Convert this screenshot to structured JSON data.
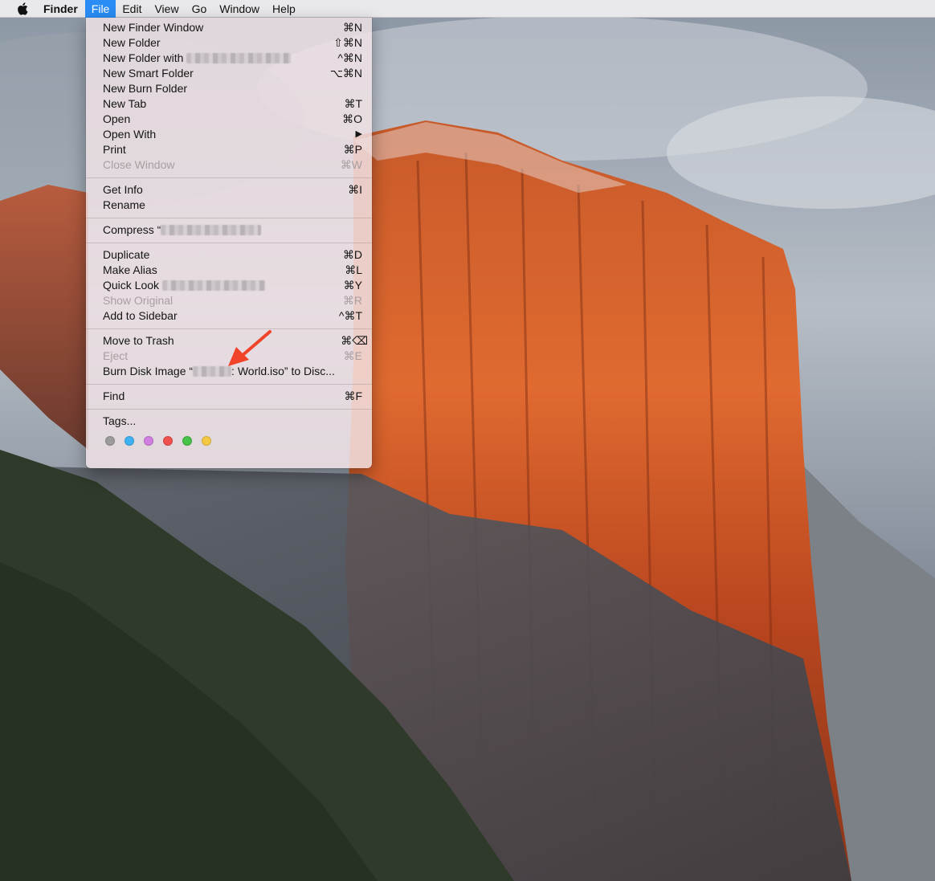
{
  "menubar": {
    "app_name": "Finder",
    "items": [
      "File",
      "Edit",
      "View",
      "Go",
      "Window",
      "Help"
    ],
    "active_item": "File"
  },
  "file_menu": {
    "groups": [
      [
        {
          "label": "New Finder Window",
          "shortcut": "⌘N"
        },
        {
          "label": "New Folder",
          "shortcut": "⇧⌘N"
        },
        {
          "label": "New Folder with",
          "shortcut": "^⌘N",
          "redacted": true
        },
        {
          "label": "New Smart Folder",
          "shortcut": "⌥⌘N"
        },
        {
          "label": "New Burn Folder",
          "shortcut": ""
        },
        {
          "label": "New Tab",
          "shortcut": "⌘T"
        },
        {
          "label": "Open",
          "shortcut": "⌘O"
        },
        {
          "label": "Open With",
          "shortcut": "▶"
        },
        {
          "label": "Print",
          "shortcut": "⌘P"
        },
        {
          "label": "Close Window",
          "shortcut": "⌘W",
          "disabled": true
        }
      ],
      [
        {
          "label": "Get Info",
          "shortcut": "⌘I"
        },
        {
          "label": "Rename",
          "shortcut": ""
        }
      ],
      [
        {
          "label": "Compress “",
          "shortcut": "",
          "redacted": true
        }
      ],
      [
        {
          "label": "Duplicate",
          "shortcut": "⌘D"
        },
        {
          "label": "Make Alias",
          "shortcut": "⌘L"
        },
        {
          "label": "Quick Look",
          "shortcut": "⌘Y",
          "redacted": true
        },
        {
          "label": "Show Original",
          "shortcut": "⌘R",
          "disabled": true
        },
        {
          "label": "Add to Sidebar",
          "shortcut": "^⌘T"
        }
      ],
      [
        {
          "label": "Move to Trash",
          "shortcut": "⌘⌫"
        },
        {
          "label": "Eject",
          "shortcut": "⌘E",
          "disabled": true
        },
        {
          "label": "Burn Disk Image “",
          "label_after": ": World.iso” to Disc...",
          "shortcut": "",
          "redacted": true
        }
      ],
      [
        {
          "label": "Find",
          "shortcut": "⌘F"
        }
      ],
      [
        {
          "label": "Tags...",
          "shortcut": ""
        }
      ]
    ],
    "tag_colors": [
      "#9b9b9b",
      "#3eb1f2",
      "#cf7fe0",
      "#f0504e",
      "#45c248",
      "#f5c842"
    ]
  },
  "annotation": {
    "icon": "red-arrow-icon",
    "color": "#f0432a"
  }
}
